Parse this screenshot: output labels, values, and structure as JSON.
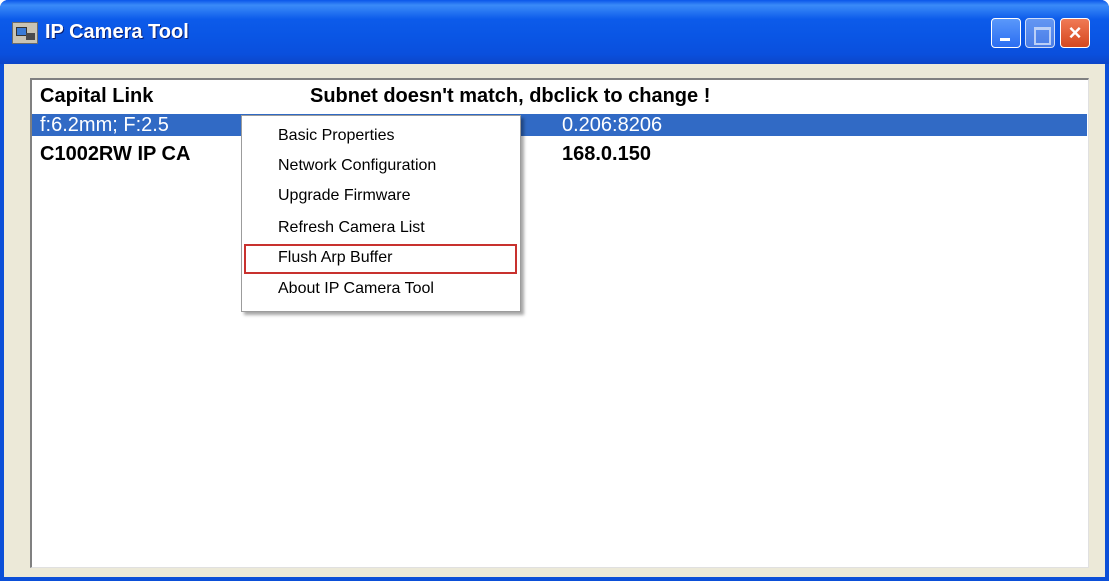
{
  "window": {
    "title": "IP Camera Tool",
    "buttons": {
      "minimize": "minimize",
      "maximize": "maximize",
      "close": "×"
    },
    "accent_color": "#0b4fd8"
  },
  "camera_list": {
    "rows": [
      {
        "name": "Capital Link",
        "detail": "Subnet doesn't match, dbclick to change !"
      },
      {
        "name": "f:6.2mm; F:2.5",
        "detail": "0.206:8206",
        "selected": true
      },
      {
        "name": "C1002RW IP CA",
        "detail": "168.0.150"
      }
    ]
  },
  "context_menu": {
    "items": [
      "Basic Properties",
      "Network Configuration",
      "Upgrade Firmware",
      "Refresh Camera List",
      "Flush Arp Buffer",
      "About IP Camera Tool"
    ],
    "highlighted_index": 4,
    "highlight_color": "#c8312e"
  }
}
